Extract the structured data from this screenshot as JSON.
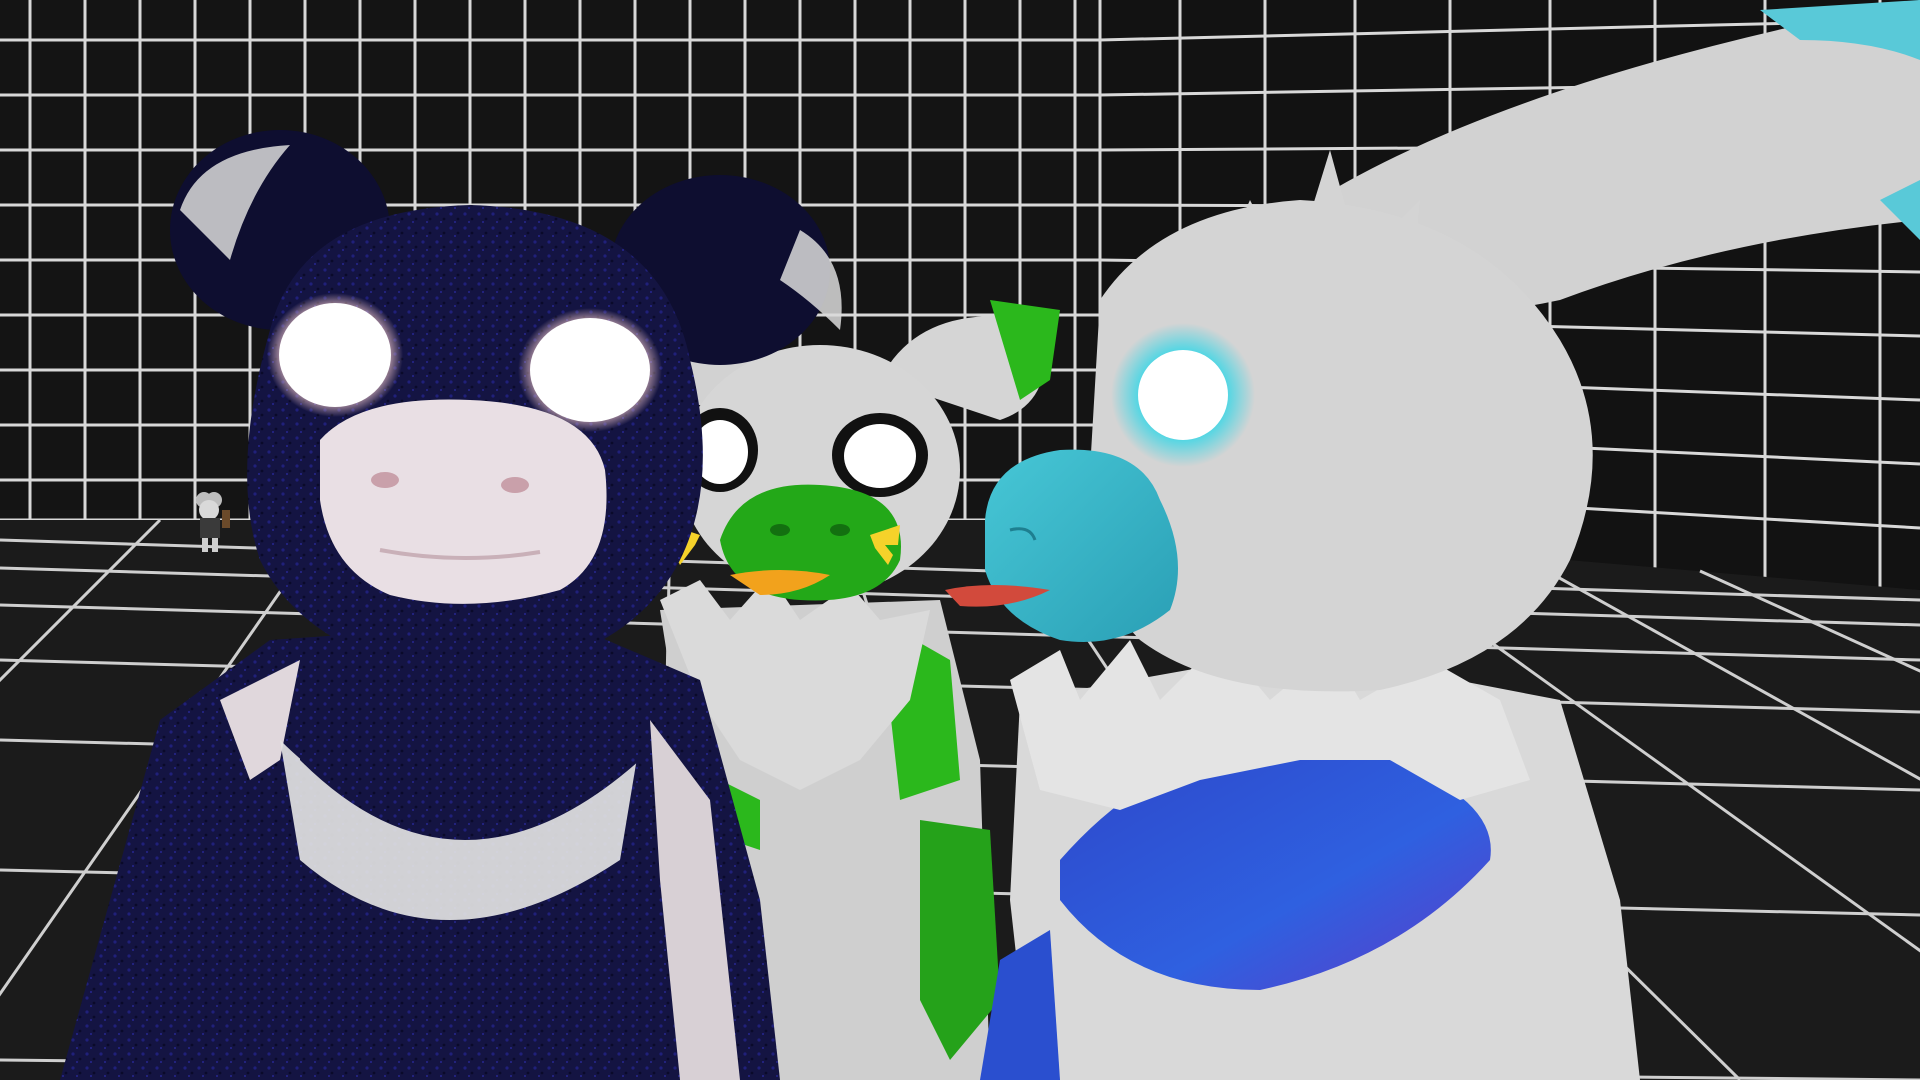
{
  "scene": {
    "colors": {
      "background": "#101010",
      "wall": "#141414",
      "grid_line": "#e6e6e6",
      "floor": "#1a1a1a",
      "navy_avatar": "#151540",
      "navy_deep": "#0b0b2a",
      "white_fur": "#dcdcdc",
      "snout_pink": "#e9dfe4",
      "green_accent": "#23b018",
      "yellow_whisker": "#f5d22a",
      "orange_tongue": "#f2a21c",
      "cyan_snout": "#3bbccc",
      "blue_chest": "#2f55d8",
      "red_tongue": "#d24a3c",
      "eye_white": "#ffffff"
    },
    "characters": [
      {
        "id": "navy-bear-avatar"
      },
      {
        "id": "green-gray-mouse-avatar"
      },
      {
        "id": "white-cyan-fox-avatar"
      },
      {
        "id": "distant-avatar"
      }
    ]
  }
}
